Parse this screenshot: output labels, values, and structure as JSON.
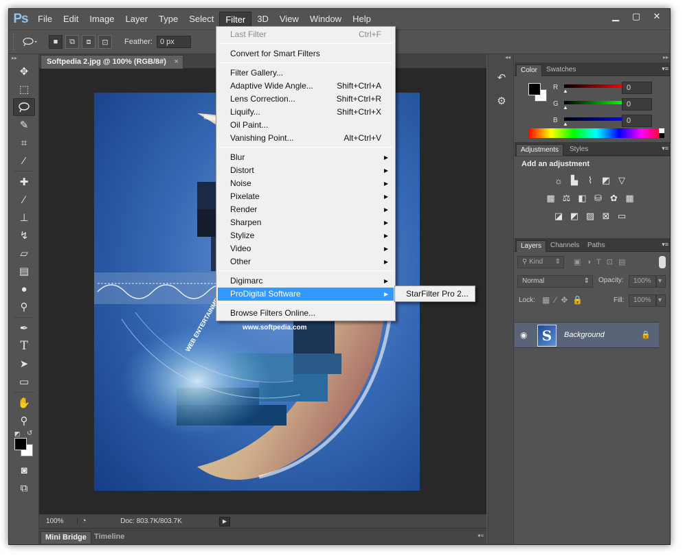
{
  "app": {
    "logo": "Ps",
    "menu": [
      "File",
      "Edit",
      "Image",
      "Layer",
      "Type",
      "Select",
      "Filter",
      "3D",
      "View",
      "Window",
      "Help"
    ],
    "active_menu": "Filter",
    "window_buttons": [
      "minimize",
      "maximize",
      "close"
    ]
  },
  "options_bar": {
    "feather_label": "Feather:",
    "feather_value": "0 px"
  },
  "document": {
    "tab_title": "Softpedia 2.jpg @ 100% (RGB/8#)",
    "close_symbol": "×",
    "status_zoom": "100%",
    "status_doc": "Doc: 803.7K/803.7K",
    "bottom_tabs": [
      "Mini Bridge",
      "Timeline"
    ],
    "artwork_text": "www.softpedia.com",
    "artwork_text2": "WEB ENTERTAINMENT"
  },
  "color_panel": {
    "tabs": [
      "Color",
      "Swatches"
    ],
    "channels": [
      {
        "label": "R",
        "value": "0",
        "gradient": "linear-gradient(90deg,#000,#ff0000)"
      },
      {
        "label": "G",
        "value": "0",
        "gradient": "linear-gradient(90deg,#000,#00ff00)"
      },
      {
        "label": "B",
        "value": "0",
        "gradient": "linear-gradient(90deg,#000,#0000ff)"
      }
    ]
  },
  "adjustments_panel": {
    "tabs": [
      "Adjustments",
      "Styles"
    ],
    "title": "Add an adjustment"
  },
  "layers_panel": {
    "tabs": [
      "Layers",
      "Channels",
      "Paths"
    ],
    "kind_label": "Kind",
    "blend_mode": "Normal",
    "opacity_label": "Opacity:",
    "opacity_value": "100%",
    "lock_label": "Lock:",
    "fill_label": "Fill:",
    "fill_value": "100%",
    "layer_name": "Background",
    "layer_thumb_letter": "S"
  },
  "filter_menu": {
    "items": [
      {
        "label": "Last Filter",
        "shortcut": "Ctrl+F",
        "disabled": true
      },
      {
        "label": "Convert for Smart Filters",
        "shortcut": ""
      },
      {
        "label": "Filter Gallery...",
        "shortcut": ""
      },
      {
        "label": "Adaptive Wide Angle...",
        "shortcut": "Shift+Ctrl+A"
      },
      {
        "label": "Lens Correction...",
        "shortcut": "Shift+Ctrl+R"
      },
      {
        "label": "Liquify...",
        "shortcut": "Shift+Ctrl+X"
      },
      {
        "label": "Oil Paint...",
        "shortcut": ""
      },
      {
        "label": "Vanishing Point...",
        "shortcut": "Alt+Ctrl+V"
      },
      {
        "label": "Blur",
        "submenu": true
      },
      {
        "label": "Distort",
        "submenu": true
      },
      {
        "label": "Noise",
        "submenu": true
      },
      {
        "label": "Pixelate",
        "submenu": true
      },
      {
        "label": "Render",
        "submenu": true
      },
      {
        "label": "Sharpen",
        "submenu": true
      },
      {
        "label": "Stylize",
        "submenu": true
      },
      {
        "label": "Video",
        "submenu": true
      },
      {
        "label": "Other",
        "submenu": true
      },
      {
        "label": "Digimarc",
        "submenu": true
      },
      {
        "label": "ProDigital Software",
        "submenu": true,
        "highlighted": true
      },
      {
        "label": "Browse Filters Online...",
        "shortcut": ""
      }
    ],
    "submenu_item": "StarFilter Pro 2..."
  },
  "colors": {
    "ui_bg": "#535353",
    "menu_highlight": "#3399ff",
    "canvas_bg": "#282828"
  }
}
